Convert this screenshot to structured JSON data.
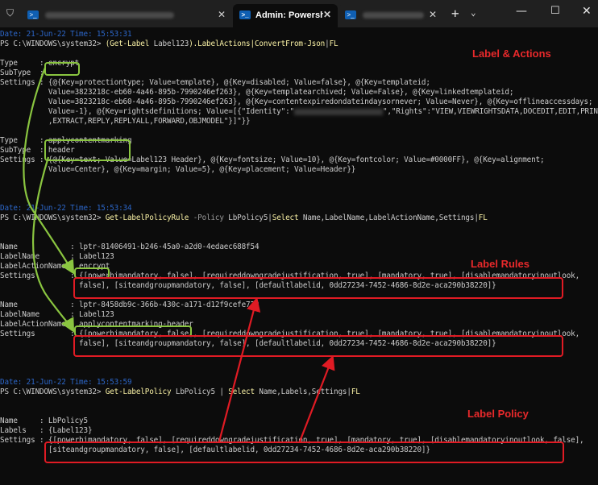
{
  "tabbar": {
    "tabs": [
      {
        "title": "",
        "icon": "powershell-icon",
        "active": false
      },
      {
        "title": "Admin: Powershell",
        "icon": "powershell-icon",
        "active": true
      },
      {
        "title": "",
        "icon": "powershell-icon",
        "active": false
      }
    ],
    "close_glyph": "✕",
    "new_tab_glyph": "+",
    "dropdown_glyph": "⌄",
    "window_controls": [
      "—",
      "☐",
      "✕"
    ]
  },
  "terminal": {
    "lines": [
      {
        "segments": [
          {
            "t": "Date: 21-Jun-22 Time: 15:53:31",
            "c": "dim"
          }
        ]
      },
      {
        "segments": [
          {
            "t": "PS C:\\WINDOWS\\system32> ",
            "c": "str"
          },
          {
            "t": "(Get-Label ",
            "c": "cmd"
          },
          {
            "t": "Label123",
            "c": "str"
          },
          {
            "t": ").LabelActions|",
            "c": "cmd"
          },
          {
            "t": "ConvertFrom-Json",
            "c": "cmd"
          },
          {
            "t": "|",
            "c": "str"
          },
          {
            "t": "FL",
            "c": "cmd"
          }
        ]
      },
      {
        "segments": [
          {
            "t": "",
            "c": "str"
          }
        ]
      },
      {
        "segments": [
          {
            "t": "Type     : encrypt",
            "c": "str"
          }
        ]
      },
      {
        "segments": [
          {
            "t": "SubType  :",
            "c": "str"
          }
        ]
      },
      {
        "segments": [
          {
            "t": "Settings : {@{Key=protectiontype; Value=template}, @{Key=disabled; Value=false}, @{Key=templateid;",
            "c": "str"
          }
        ]
      },
      {
        "segments": [
          {
            "t": "           Value=3823218c-eb60-4a46-895b-7990246ef263}, @{Key=templatearchived; Value=False}, @{Key=linkedtemplateid;",
            "c": "str"
          }
        ]
      },
      {
        "segments": [
          {
            "t": "           Value=3823218c-eb60-4a46-895b-7990246ef263}, @{Key=contentexpiredondateindaysornever; Value=Never}, @{Key=offlineaccessdays;",
            "c": "str"
          }
        ]
      },
      {
        "segments": [
          {
            "t": "           Value=-1}, @{Key=rightsdefinitions; Value=[{\"Identity\":\"",
            "c": "str"
          },
          {
            "t": "",
            "c": "blur"
          },
          {
            "t": "\",\"Rights\":\"VIEW,VIEWRIGHTSDATA,DOCEDIT,EDIT,PRINT",
            "c": "str"
          }
        ]
      },
      {
        "segments": [
          {
            "t": "           ,EXTRACT,REPLY,REPLYALL,FORWARD,OBJMODEL\"}]\"}}",
            "c": "str"
          }
        ]
      },
      {
        "segments": [
          {
            "t": "",
            "c": "str"
          }
        ]
      },
      {
        "segments": [
          {
            "t": "Type     : applycontentmarking",
            "c": "str"
          }
        ]
      },
      {
        "segments": [
          {
            "t": "SubType  : header",
            "c": "str"
          }
        ]
      },
      {
        "segments": [
          {
            "t": "Settings : {@{Key=text; Value=Label123 Header}, @{Key=fontsize; Value=10}, @{Key=fontcolor; Value=#0000FF}, @{Key=alignment;",
            "c": "str"
          }
        ]
      },
      {
        "segments": [
          {
            "t": "           Value=Center}, @{Key=margin; Value=5}, @{Key=placement; Value=Header}}",
            "c": "str"
          }
        ]
      },
      {
        "segments": [
          {
            "t": "",
            "c": "str"
          }
        ]
      },
      {
        "segments": [
          {
            "t": "",
            "c": "str"
          }
        ]
      },
      {
        "segments": [
          {
            "t": "",
            "c": "str"
          }
        ]
      },
      {
        "segments": [
          {
            "t": "Date: 21-Jun-22 Time: 15:53:34",
            "c": "dim"
          }
        ]
      },
      {
        "segments": [
          {
            "t": "PS C:\\WINDOWS\\system32> ",
            "c": "str"
          },
          {
            "t": "Get-LabelPolicyRule ",
            "c": "cmd"
          },
          {
            "t": "-Policy ",
            "c": "param"
          },
          {
            "t": "LbPolicy5|",
            "c": "str"
          },
          {
            "t": "Select ",
            "c": "cmd"
          },
          {
            "t": "Name,LabelName,LabelActionName,Settings|",
            "c": "str"
          },
          {
            "t": "FL",
            "c": "cmd"
          }
        ]
      },
      {
        "segments": [
          {
            "t": "",
            "c": "str"
          }
        ]
      },
      {
        "segments": [
          {
            "t": "",
            "c": "str"
          }
        ]
      },
      {
        "segments": [
          {
            "t": "Name            : lptr-81406491-b246-45a0-a2d0-4edaec688f54",
            "c": "str"
          }
        ]
      },
      {
        "segments": [
          {
            "t": "LabelName       : Label123",
            "c": "str"
          }
        ]
      },
      {
        "segments": [
          {
            "t": "LabelActionName : encrypt",
            "c": "str"
          }
        ]
      },
      {
        "segments": [
          {
            "t": "Settings        : {[powerbimandatory, false], [requireddowngradejustification, true], [mandatory, true], [disablemandatoryinoutlook,",
            "c": "str"
          }
        ]
      },
      {
        "segments": [
          {
            "t": "                  false], [siteandgroupmandatory, false], [defaultlabelid, 0dd27234-7452-4686-8d2e-aca290b38220]}",
            "c": "str"
          }
        ]
      },
      {
        "segments": [
          {
            "t": "",
            "c": "str"
          }
        ]
      },
      {
        "segments": [
          {
            "t": "Name            : lptr-8458db9c-366b-430c-a171-d12f9cefe722",
            "c": "str"
          }
        ]
      },
      {
        "segments": [
          {
            "t": "LabelName       : Label123",
            "c": "str"
          }
        ]
      },
      {
        "segments": [
          {
            "t": "LabelActionName : applycontentmarking-header",
            "c": "str"
          }
        ]
      },
      {
        "segments": [
          {
            "t": "Settings        : {[powerbimandatory, false], [requireddowngradejustification, true], [mandatory, true], [disablemandatoryinoutlook,",
            "c": "str"
          }
        ]
      },
      {
        "segments": [
          {
            "t": "                  false], [siteandgroupmandatory, false], [defaultlabelid, 0dd27234-7452-4686-8d2e-aca290b38220]}",
            "c": "str"
          }
        ]
      },
      {
        "segments": [
          {
            "t": "",
            "c": "str"
          }
        ]
      },
      {
        "segments": [
          {
            "t": "",
            "c": "str"
          }
        ]
      },
      {
        "segments": [
          {
            "t": "",
            "c": "str"
          }
        ]
      },
      {
        "segments": [
          {
            "t": "Date: 21-Jun-22 Time: 15:53:59",
            "c": "dim"
          }
        ]
      },
      {
        "segments": [
          {
            "t": "PS C:\\WINDOWS\\system32> ",
            "c": "str"
          },
          {
            "t": "Get-LabelPolicy ",
            "c": "cmd"
          },
          {
            "t": "LbPolicy5 | ",
            "c": "str"
          },
          {
            "t": "Select ",
            "c": "cmd"
          },
          {
            "t": "Name,Labels,Settings|",
            "c": "str"
          },
          {
            "t": "FL",
            "c": "cmd"
          }
        ]
      },
      {
        "segments": [
          {
            "t": "",
            "c": "str"
          }
        ]
      },
      {
        "segments": [
          {
            "t": "",
            "c": "str"
          }
        ]
      },
      {
        "segments": [
          {
            "t": "Name     : LbPolicy5",
            "c": "str"
          }
        ]
      },
      {
        "segments": [
          {
            "t": "Labels   : {Label123}",
            "c": "str"
          }
        ]
      },
      {
        "segments": [
          {
            "t": "Settings : {[powerbimandatory, false], [requireddowngradejustification, true], [mandatory, true], [disablemandatoryinoutlook, false],",
            "c": "str"
          }
        ]
      },
      {
        "segments": [
          {
            "t": "           [siteandgroupmandatory, false], [defaultlabelid, 0dd27234-7452-4686-8d2e-aca290b38220]}",
            "c": "str"
          }
        ]
      }
    ]
  },
  "annotations": {
    "label_actions": "Label & Actions",
    "label_rules": "Label Rules",
    "label_policy": "Label Policy"
  },
  "colors": {
    "terminal_bg": "#0c0c0c",
    "highlight_green": "#8ac540",
    "highlight_red": "#e01b24",
    "prompt_date": "#2c66c8",
    "command": "#f9f1a5"
  }
}
